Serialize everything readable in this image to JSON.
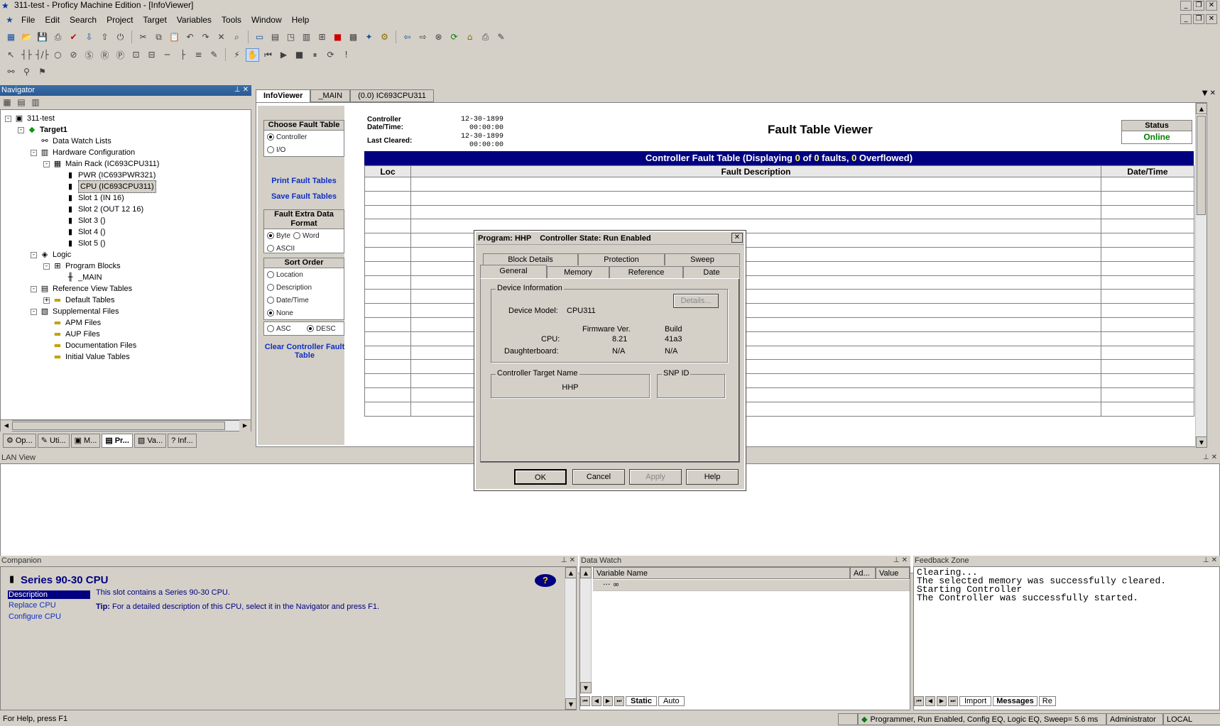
{
  "window": {
    "title": "311-test - Proficy Machine Edition - [InfoViewer]"
  },
  "menu": [
    "File",
    "Edit",
    "Search",
    "Project",
    "Target",
    "Variables",
    "Tools",
    "Window",
    "Help"
  ],
  "navigator": {
    "title": "Navigator",
    "tree": [
      {
        "label": "311-test",
        "level": 0,
        "icon": "project-icon",
        "exp": "-"
      },
      {
        "label": "Target1",
        "level": 1,
        "icon": "target-icon",
        "exp": "-",
        "bold": true
      },
      {
        "label": "Data Watch Lists",
        "level": 2,
        "icon": "watch-icon",
        "exp": ""
      },
      {
        "label": "Hardware Configuration",
        "level": 2,
        "icon": "hardware-icon",
        "exp": "-"
      },
      {
        "label": "Main Rack (IC693CPU311)",
        "level": 3,
        "icon": "rack-icon",
        "exp": "-"
      },
      {
        "label": "PWR (IC693PWR321)",
        "level": 4,
        "icon": "module-icon",
        "exp": ""
      },
      {
        "label": "CPU (IC693CPU311)",
        "level": 4,
        "icon": "module-icon",
        "exp": "",
        "selected": true
      },
      {
        "label": "Slot 1 (IN 16)",
        "level": 4,
        "icon": "module-icon",
        "exp": ""
      },
      {
        "label": "Slot 2 (OUT 12 16)",
        "level": 4,
        "icon": "module-icon",
        "exp": ""
      },
      {
        "label": "Slot 3 ()",
        "level": 4,
        "icon": "module-icon",
        "exp": ""
      },
      {
        "label": "Slot 4 ()",
        "level": 4,
        "icon": "module-icon",
        "exp": ""
      },
      {
        "label": "Slot 5 ()",
        "level": 4,
        "icon": "module-icon",
        "exp": ""
      },
      {
        "label": "Logic",
        "level": 2,
        "icon": "logic-icon",
        "exp": "-"
      },
      {
        "label": "Program Blocks",
        "level": 3,
        "icon": "program-icon",
        "exp": "-"
      },
      {
        "label": "_MAIN",
        "level": 4,
        "icon": "ladder-icon",
        "exp": ""
      },
      {
        "label": "Reference View Tables",
        "level": 2,
        "icon": "table-icon",
        "exp": "-"
      },
      {
        "label": "Default Tables",
        "level": 3,
        "icon": "folder-icon",
        "exp": "+"
      },
      {
        "label": "Supplemental Files",
        "level": 2,
        "icon": "files-icon",
        "exp": "-"
      },
      {
        "label": "APM Files",
        "level": 3,
        "icon": "folder-icon",
        "exp": ""
      },
      {
        "label": "AUP Files",
        "level": 3,
        "icon": "folder-icon",
        "exp": ""
      },
      {
        "label": "Documentation Files",
        "level": 3,
        "icon": "folder-icon",
        "exp": ""
      },
      {
        "label": "Initial Value Tables",
        "level": 3,
        "icon": "folder-icon",
        "exp": ""
      }
    ],
    "tabs": [
      "Op...",
      "Uti...",
      "M...",
      "Pr...",
      "Va...",
      "Inf..."
    ]
  },
  "doc_tabs": [
    "InfoViewer",
    "_MAIN",
    "(0.0) IC693CPU311"
  ],
  "fault_left": {
    "choose_title": "Choose Fault Table",
    "controller": "Controller",
    "io": "I/O",
    "print": "Print Fault Tables",
    "save": "Save Fault Tables",
    "extra_title": "Fault Extra Data Format",
    "byte": "Byte",
    "word": "Word",
    "ascii": "ASCII",
    "sort_title": "Sort Order",
    "location": "Location",
    "description": "Description",
    "datetime": "Date/Time",
    "none": "None",
    "asc": "ASC",
    "desc": "DESC",
    "clear": "Clear Controller Fault Table"
  },
  "fault_viewer": {
    "controller_dt_label": "Controller Date/Time:",
    "controller_dt_value": "12-30-1899 00:00:00",
    "last_cleared_label": "Last Cleared:",
    "last_cleared_value": "12-30-1899 00:00:00",
    "title": "Fault Table Viewer",
    "status_label": "Status",
    "status_value": "Online",
    "table_header_pre": "Controller Fault Table (Displaying ",
    "displaying": "0",
    "of_text": " of ",
    "total": "0",
    "faults_text": " faults, ",
    "overflowed": "0",
    "overflowed_text": " Overflowed)",
    "col_loc": "Loc",
    "col_desc": "Fault Description",
    "col_dt": "Date/Time"
  },
  "dialog": {
    "title": "Program: HHP    Controller State: Run Enabled",
    "tabs_back": [
      "Block Details",
      "Protection",
      "Sweep"
    ],
    "tabs_front": [
      "General",
      "Memory",
      "Reference",
      "Date"
    ],
    "device_info": "Device Information",
    "details_btn": "Details...",
    "device_model_label": "Device Model:",
    "device_model": "CPU311",
    "firmware_label": "Firmware Ver.",
    "build_label": "Build",
    "cpu_label": "CPU:",
    "cpu_fw": "8.21",
    "cpu_build": "41a3",
    "db_label": "Daughterboard:",
    "db_fw": "N/A",
    "db_build": "N/A",
    "target_name_label": "Controller Target Name",
    "target_name": "HHP",
    "snp_label": "SNP ID",
    "ok": "OK",
    "cancel": "Cancel",
    "apply": "Apply",
    "help": "Help"
  },
  "lan_view": {
    "title": "LAN View"
  },
  "companion": {
    "title": "Companion",
    "heading": "Series 90-30 CPU",
    "links": [
      "Description",
      "Replace CPU",
      "Configure CPU"
    ],
    "text": "This slot contains a Series 90-30 CPU.",
    "tip_label": "Tip:",
    "tip": "For a detailed description of this CPU, select it in the Navigator and press F1."
  },
  "data_watch": {
    "title": "Data Watch",
    "cols": [
      "Variable Name",
      "Ad...",
      "Value"
    ],
    "tabs": [
      "Static",
      "Auto"
    ]
  },
  "feedback": {
    "title": "Feedback Zone",
    "lines": [
      "Clearing...",
      "The selected memory was successfully cleared.",
      "Starting Controller",
      "The Controller was successfully started."
    ],
    "tabs": [
      "Import",
      "Messages",
      "Re"
    ]
  },
  "status_bar": {
    "help": "For Help, press F1",
    "state": "Programmer, Run Enabled, Config EQ, Logic EQ, Sweep= 5.6 ms",
    "user": "Administrator",
    "mode": "LOCAL"
  },
  "colors": {
    "navy": "#000080",
    "online": "#008000",
    "link": "#1030c0"
  }
}
